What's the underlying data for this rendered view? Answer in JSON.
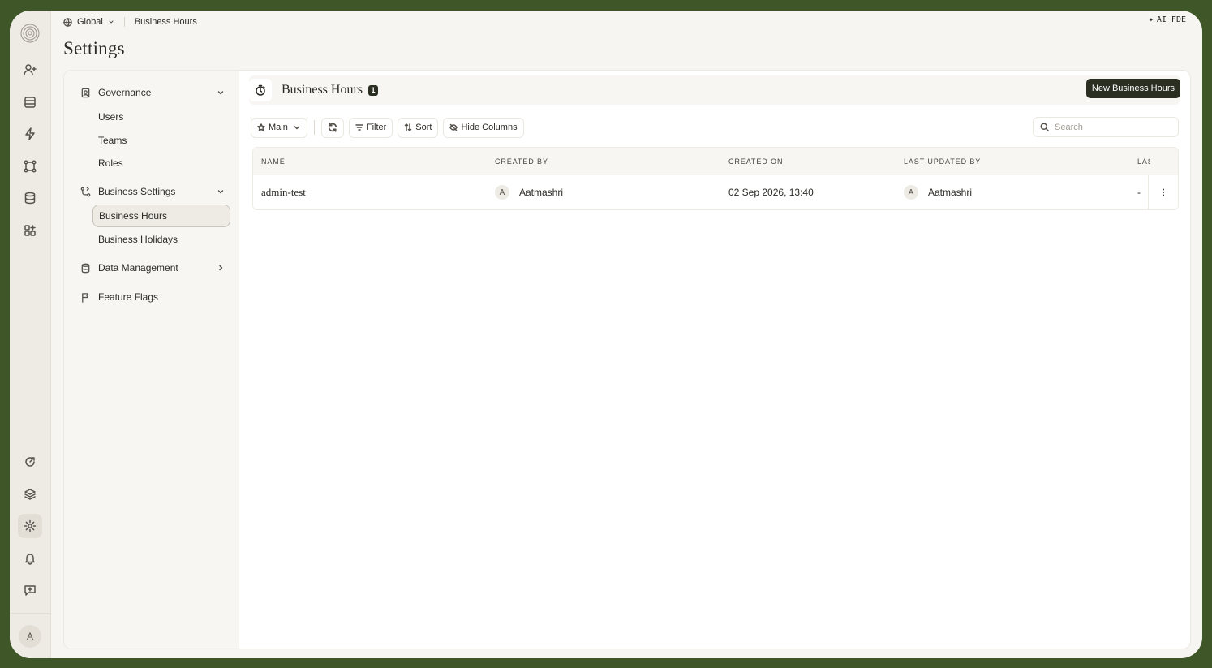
{
  "breadcrumb": {
    "scope": "Global",
    "current": "Business Hours"
  },
  "ai_label": "AI FDE",
  "page_title": "Settings",
  "sidenav": {
    "governance": {
      "label": "Governance",
      "items": [
        "Users",
        "Teams",
        "Roles"
      ]
    },
    "business_settings": {
      "label": "Business Settings",
      "items": [
        "Business Hours",
        "Business Holidays"
      ],
      "active": "Business Hours"
    },
    "data_management": {
      "label": "Data Management"
    },
    "feature_flags": {
      "label": "Feature Flags"
    }
  },
  "content": {
    "title": "Business Hours",
    "count": "1",
    "new_button": "New Business Hours"
  },
  "toolbar": {
    "view": "Main",
    "filter": "Filter",
    "sort": "Sort",
    "hide_columns": "Hide Columns",
    "search_placeholder": "Search"
  },
  "table": {
    "columns": [
      "NAME",
      "CREATED BY",
      "CREATED ON",
      "LAST UPDATED BY",
      "LAS"
    ],
    "rows": [
      {
        "name": "admin-test",
        "created_by_initial": "A",
        "created_by": "Aatmashri",
        "created_on": "02 Sep 2026, 13:40",
        "updated_by_initial": "A",
        "updated_by": "Aatmashri",
        "last": "-"
      }
    ]
  },
  "user_avatar": "A",
  "icons": [
    "spiral-logo",
    "user-plus-icon",
    "inbox-icon",
    "bolt-icon",
    "workflow-icon",
    "database-icon",
    "apps-icon",
    "agent-icon",
    "layers-icon",
    "gear-icon",
    "bell-icon",
    "feedback-icon"
  ]
}
